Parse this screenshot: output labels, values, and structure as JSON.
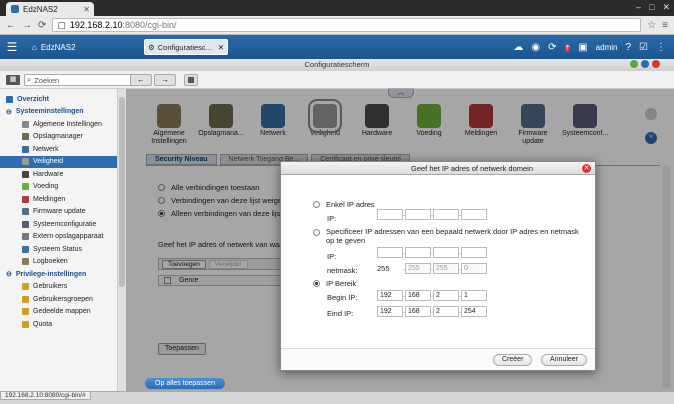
{
  "browser": {
    "tab_title": "EdzNAS2",
    "url_host": "192.168.2.10",
    "url_path": ":8080/cgi-bin/",
    "status_url": "192.168.2.10:8080/cgi-bin/#"
  },
  "topbar": {
    "home_label": "EdzNAS2",
    "app_button": "Configuratiesc...",
    "user": "admin"
  },
  "window_title": "Configuratiescherm",
  "search": {
    "placeholder": "Zoeken"
  },
  "sidebar": {
    "overview": "Overzicht",
    "system_section": "Systeeminstellingen",
    "items": [
      "Algemene Instellingen",
      "Opslagmanager",
      "Netwerk",
      "Veiligheid",
      "Hardware",
      "Voeding",
      "Meldingen",
      "Firmware update",
      "Systeemconfiguratie",
      "Extern opslagapparaat",
      "Systeem Status",
      "Logboeken"
    ],
    "privilege_section": "Privilege-instellingen",
    "priv_items": [
      "Gebruikers",
      "Gebruikersgroepen",
      "Gedeelde mappen",
      "Quota"
    ]
  },
  "icons": [
    {
      "label": "Algemene Instellingen",
      "color": "#8a7b5a"
    },
    {
      "label": "Opslagmana...",
      "color": "#6b6b4a"
    },
    {
      "label": "Netwerk",
      "color": "#3a6ea5"
    },
    {
      "label": "Veiligheid",
      "color": "#9a9a9a"
    },
    {
      "label": "Hardware",
      "color": "#4a4a4a"
    },
    {
      "label": "Voeding",
      "color": "#6cae3c"
    },
    {
      "label": "Meldingen",
      "color": "#b03a3a"
    },
    {
      "label": "Firmware update",
      "color": "#556b8a"
    },
    {
      "label": "Systeemconf...",
      "color": "#5a5a7a"
    }
  ],
  "tabs": [
    "Security Niveau",
    "Netwerk Toegang Be...",
    "Certificaat en prive sleutel"
  ],
  "options": [
    "Alle verbindingen toestaan",
    "Verbindingen van deze lijst weigeren",
    "Alleen verbindingen van deze lijst t..."
  ],
  "net_label": "Geef het IP adres of netwerk van waar...",
  "filter": {
    "add": "Toevoegen",
    "remove": "Verwijder"
  },
  "table": {
    "col": "Genre"
  },
  "apply": "Toepassen",
  "apply_all": "Op alles toepassen",
  "dialog": {
    "title": "Geef het IP adres of netwerk domein",
    "single_ip": "Enkel IP adres",
    "ip_label": "IP:",
    "network_option": "Specificeer IP adressen van een bepaald netwerk door IP adres en netmask op te geven",
    "netmask_label": "netmask:",
    "netmask_values": [
      "255",
      "255",
      "255",
      "0"
    ],
    "range_option": "IP Bereik",
    "begin_label": "Begin IP:",
    "begin_ip": [
      "192",
      "168",
      "2",
      "1"
    ],
    "end_label": "Eind IP:",
    "end_ip": [
      "192",
      "168",
      "2",
      "254"
    ],
    "create": "Creëer",
    "cancel": "Annuleer"
  }
}
